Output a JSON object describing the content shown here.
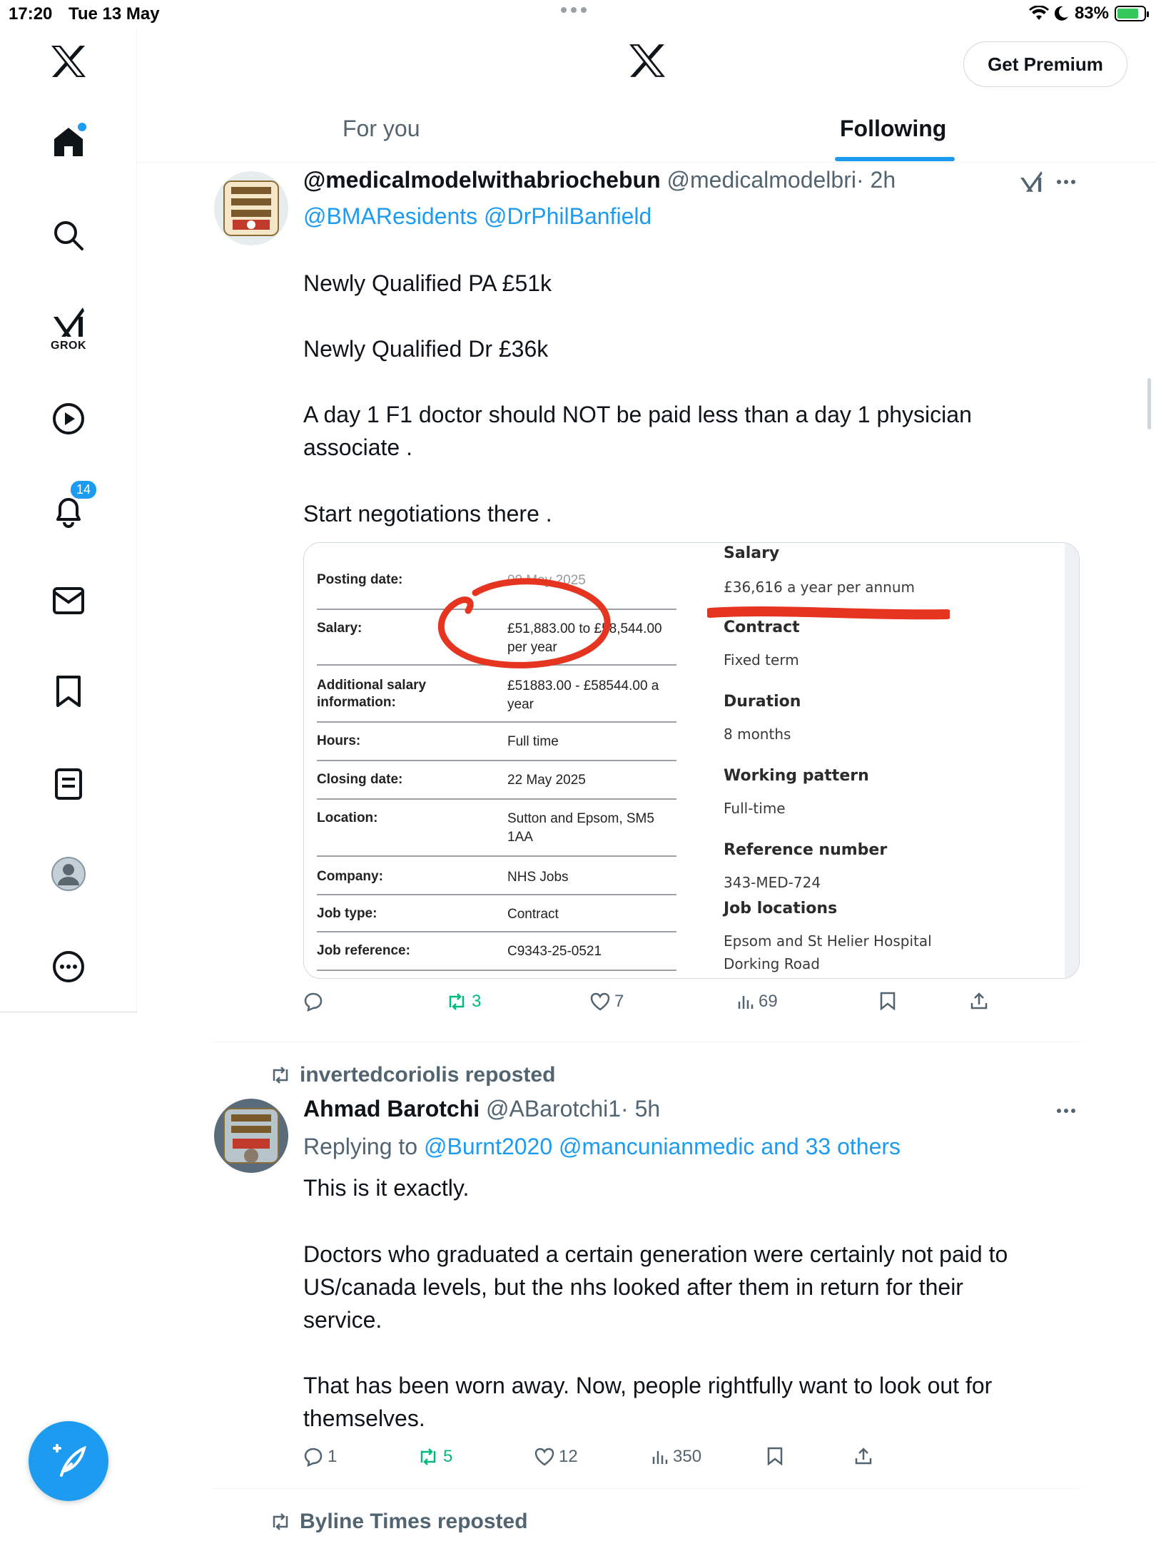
{
  "status_bar": {
    "time": "17:20",
    "date": "Tue 13 May",
    "battery": "83%"
  },
  "header": {
    "premium_label": "Get Premium"
  },
  "tabs": [
    {
      "label": "For you"
    },
    {
      "label": "Following"
    }
  ],
  "sidebar": {
    "grok_label": "GROK",
    "notifications_count": "14"
  },
  "tweet1": {
    "display_name": "@medicalmodelwithabriochebun",
    "handle": "@medicalmodelbri",
    "time": "· 2h",
    "mentions": "@BMAResidents @DrPhilBanfield",
    "lines": [
      "Newly Qualified PA £51k",
      "Newly Qualified Dr £36k",
      "A day 1 F1 doctor should NOT be paid less than a day 1 physician",
      "associate .",
      "Start negotiations there ."
    ],
    "actions": {
      "replies": "",
      "reposts": "3",
      "likes": "7",
      "views": "69"
    }
  },
  "job_ad": {
    "rows": [
      {
        "label": "Posting date:",
        "value": "09 May 2025"
      },
      {
        "label": "Salary:",
        "value": "£51,883.00 to £58,544.00 per year"
      },
      {
        "label": "Additional salary information:",
        "value": "£51883.00 - £58544.00 a year"
      },
      {
        "label": "Hours:",
        "value": "Full time"
      },
      {
        "label": "Closing date:",
        "value": "22 May 2025"
      },
      {
        "label": "Location:",
        "value": "Sutton and Epsom, SM5 1AA"
      },
      {
        "label": "Company:",
        "value": "NHS Jobs"
      },
      {
        "label": "Job type:",
        "value": "Contract"
      },
      {
        "label": "Job reference:",
        "value": "C9343-25-0521"
      }
    ],
    "right": {
      "salary_h": "Salary",
      "salary_v": "£36,616 a year per annum",
      "contract_h": "Contract",
      "contract_v": "Fixed term",
      "duration_h": "Duration",
      "duration_v": "8 months",
      "pattern_h": "Working pattern",
      "pattern_v": "Full-time",
      "ref_h": "Reference number",
      "ref_v": "343-MED-724",
      "loc_h": "Job locations",
      "loc_v1": "Epsom and St Helier Hospital",
      "loc_v2": "Dorking Road"
    }
  },
  "tweet2": {
    "repost_by": "invertedcoriolis reposted",
    "display_name": "Ahmad Barotchi",
    "handle": "@ABarotchi1",
    "time": "· 5h",
    "replying_prefix": "Replying to",
    "replying_to": "@Burnt2020 @mancunianmedic and 33 others",
    "lines": [
      "This is it exactly.",
      "Doctors who graduated a certain generation were certainly not paid to",
      "US/canada levels, but the nhs looked after them in return for their",
      "service.",
      "That has been worn away. Now, people rightfully want to look out for",
      "themselves."
    ],
    "actions": {
      "replies": "1",
      "reposts": "5",
      "likes": "12",
      "views": "350"
    }
  },
  "tweet3": {
    "repost_by": "Byline Times reposted"
  },
  "colors": {
    "accent": "#1d9bf0",
    "repost_green": "#00ba7c",
    "annotation_red": "#e5341f"
  }
}
